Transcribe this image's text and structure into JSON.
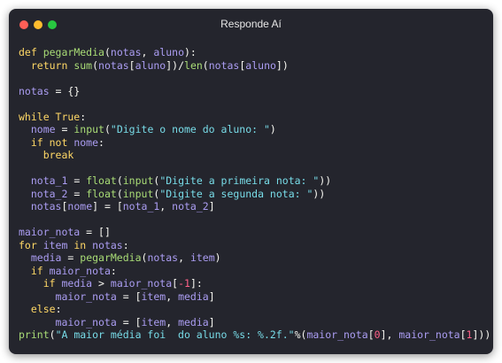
{
  "window": {
    "title": "Responde Aí",
    "controls": {
      "close": "#ff5f57",
      "minimize": "#febc2e",
      "maximize": "#28c840"
    },
    "background": "#24252d"
  },
  "syntax_colors": {
    "keyword": "#ffd866",
    "function": "#a9dc76",
    "string": "#78dce8",
    "number": "#ff6188",
    "variable": "#ab9df2",
    "plain": "#f8f8f2"
  },
  "code_lines": [
    [
      [
        "kw",
        "def "
      ],
      [
        "fn",
        "pegarMedia"
      ],
      [
        "pl",
        "("
      ],
      [
        "var",
        "notas"
      ],
      [
        "pl",
        ", "
      ],
      [
        "var",
        "aluno"
      ],
      [
        "pl",
        "):"
      ]
    ],
    [
      [
        "pl",
        "  "
      ],
      [
        "kw",
        "return "
      ],
      [
        "fn",
        "sum"
      ],
      [
        "pl",
        "("
      ],
      [
        "var",
        "notas"
      ],
      [
        "pl",
        "["
      ],
      [
        "var",
        "aluno"
      ],
      [
        "pl",
        "])/"
      ],
      [
        "fn",
        "len"
      ],
      [
        "pl",
        "("
      ],
      [
        "var",
        "notas"
      ],
      [
        "pl",
        "["
      ],
      [
        "var",
        "aluno"
      ],
      [
        "pl",
        "])"
      ]
    ],
    [],
    [
      [
        "var",
        "notas"
      ],
      [
        "pl",
        " = {}"
      ]
    ],
    [],
    [
      [
        "kw",
        "while True"
      ],
      [
        "pl",
        ":"
      ]
    ],
    [
      [
        "pl",
        "  "
      ],
      [
        "var",
        "nome"
      ],
      [
        "pl",
        " = "
      ],
      [
        "fn",
        "input"
      ],
      [
        "pl",
        "("
      ],
      [
        "str",
        "\"Digite o nome do aluno: \""
      ],
      [
        "pl",
        ")"
      ]
    ],
    [
      [
        "pl",
        "  "
      ],
      [
        "kw",
        "if not "
      ],
      [
        "var",
        "nome"
      ],
      [
        "pl",
        ":"
      ]
    ],
    [
      [
        "pl",
        "    "
      ],
      [
        "kw",
        "break"
      ]
    ],
    [],
    [
      [
        "pl",
        "  "
      ],
      [
        "var",
        "nota_1"
      ],
      [
        "pl",
        " = "
      ],
      [
        "fn",
        "float"
      ],
      [
        "pl",
        "("
      ],
      [
        "fn",
        "input"
      ],
      [
        "pl",
        "("
      ],
      [
        "str",
        "\"Digite a primeira nota: \""
      ],
      [
        "pl",
        "))"
      ]
    ],
    [
      [
        "pl",
        "  "
      ],
      [
        "var",
        "nota_2"
      ],
      [
        "pl",
        " = "
      ],
      [
        "fn",
        "float"
      ],
      [
        "pl",
        "("
      ],
      [
        "fn",
        "input"
      ],
      [
        "pl",
        "("
      ],
      [
        "str",
        "\"Digite a segunda nota: \""
      ],
      [
        "pl",
        "))"
      ]
    ],
    [
      [
        "pl",
        "  "
      ],
      [
        "var",
        "notas"
      ],
      [
        "pl",
        "["
      ],
      [
        "var",
        "nome"
      ],
      [
        "pl",
        "] = ["
      ],
      [
        "var",
        "nota_1"
      ],
      [
        "pl",
        ", "
      ],
      [
        "var",
        "nota_2"
      ],
      [
        "pl",
        "]"
      ]
    ],
    [],
    [
      [
        "var",
        "maior_nota"
      ],
      [
        "pl",
        " = []"
      ]
    ],
    [
      [
        "kw",
        "for "
      ],
      [
        "var",
        "item"
      ],
      [
        "kw",
        " in "
      ],
      [
        "var",
        "notas"
      ],
      [
        "pl",
        ":"
      ]
    ],
    [
      [
        "pl",
        "  "
      ],
      [
        "var",
        "media"
      ],
      [
        "pl",
        " = "
      ],
      [
        "fn",
        "pegarMedia"
      ],
      [
        "pl",
        "("
      ],
      [
        "var",
        "notas"
      ],
      [
        "pl",
        ", "
      ],
      [
        "var",
        "item"
      ],
      [
        "pl",
        ")"
      ]
    ],
    [
      [
        "pl",
        "  "
      ],
      [
        "kw",
        "if "
      ],
      [
        "var",
        "maior_nota"
      ],
      [
        "pl",
        ":"
      ]
    ],
    [
      [
        "pl",
        "    "
      ],
      [
        "kw",
        "if "
      ],
      [
        "var",
        "media"
      ],
      [
        "pl",
        " > "
      ],
      [
        "var",
        "maior_nota"
      ],
      [
        "pl",
        "["
      ],
      [
        "num",
        "-1"
      ],
      [
        "pl",
        "]:"
      ]
    ],
    [
      [
        "pl",
        "      "
      ],
      [
        "var",
        "maior_nota"
      ],
      [
        "pl",
        " = ["
      ],
      [
        "var",
        "item"
      ],
      [
        "pl",
        ", "
      ],
      [
        "var",
        "media"
      ],
      [
        "pl",
        "]"
      ]
    ],
    [
      [
        "pl",
        "  "
      ],
      [
        "kw",
        "else"
      ],
      [
        "pl",
        ":"
      ]
    ],
    [
      [
        "pl",
        "      "
      ],
      [
        "var",
        "maior_nota"
      ],
      [
        "pl",
        " = ["
      ],
      [
        "var",
        "item"
      ],
      [
        "pl",
        ", "
      ],
      [
        "var",
        "media"
      ],
      [
        "pl",
        "]"
      ]
    ],
    [
      [
        "fn",
        "print"
      ],
      [
        "pl",
        "("
      ],
      [
        "str",
        "\"A maior média foi  do aluno %s: %.2f.\""
      ],
      [
        "pl",
        "%("
      ],
      [
        "var",
        "maior_nota"
      ],
      [
        "pl",
        "["
      ],
      [
        "num",
        "0"
      ],
      [
        "pl",
        "], "
      ],
      [
        "var",
        "maior_nota"
      ],
      [
        "pl",
        "["
      ],
      [
        "num",
        "1"
      ],
      [
        "pl",
        "]))"
      ]
    ]
  ]
}
